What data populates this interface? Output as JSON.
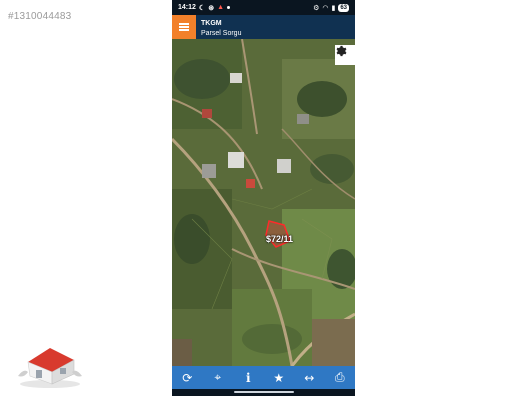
{
  "watermark": {
    "listing_id": "#1310044483"
  },
  "status_bar": {
    "time": "14:12",
    "left_icons": [
      "moon-icon",
      "notification-icon",
      "alert-icon",
      "dot-icon"
    ],
    "right_icons": [
      "settings-small-icon",
      "wifi-icon",
      "signal-icon"
    ],
    "battery": "63"
  },
  "app_bar": {
    "title": "TKGM",
    "subtitle": "Parsel Sorgu",
    "menu_icon": "hamburger-icon"
  },
  "map": {
    "view": "satellite",
    "parcel_label": "$72/11",
    "settings_icon": "gear-icon"
  },
  "toolbar": {
    "items": [
      {
        "icon": "refresh-icon",
        "glyph": "⟳"
      },
      {
        "icon": "locate-icon",
        "glyph": "⌖"
      },
      {
        "icon": "info-icon",
        "glyph": "i"
      },
      {
        "icon": "star-icon",
        "glyph": "★"
      },
      {
        "icon": "measure-icon",
        "glyph": "↔"
      },
      {
        "icon": "print-icon",
        "glyph": "⎙"
      }
    ]
  },
  "colors": {
    "app_bar": "#103151",
    "menu_button": "#f2802a",
    "toolbar": "#2f78c4",
    "parcel_outline": "#ff2a2a"
  }
}
